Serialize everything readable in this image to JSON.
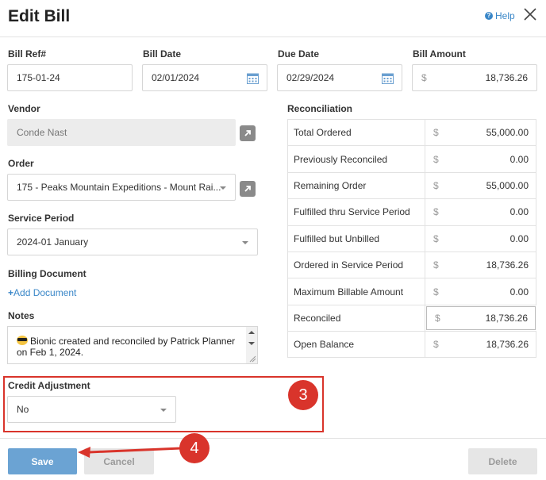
{
  "header": {
    "title": "Edit Bill",
    "help_label": "Help"
  },
  "fields": {
    "bill_ref": {
      "label": "Bill Ref#",
      "value": "175-01-24"
    },
    "bill_date": {
      "label": "Bill Date",
      "value": "02/01/2024"
    },
    "due_date": {
      "label": "Due Date",
      "value": "02/29/2024"
    },
    "bill_amount": {
      "label": "Bill Amount",
      "currency": "$",
      "value": "18,736.26"
    },
    "vendor": {
      "label": "Vendor",
      "value": "Conde Nast"
    },
    "order": {
      "label": "Order",
      "value": "175 - Peaks Mountain Expeditions - Mount Rai..."
    },
    "service_period": {
      "label": "Service Period",
      "value": "2024-01 January"
    },
    "billing_document": {
      "label": "Billing Document",
      "add_label": "Add Document"
    },
    "notes": {
      "label": "Notes",
      "value": "Bionic created and reconciled by Patrick Planner on Feb 1, 2024."
    },
    "credit_adjustment": {
      "label": "Credit Adjustment",
      "value": "No"
    }
  },
  "reconciliation": {
    "title": "Reconciliation",
    "currency": "$",
    "rows": [
      {
        "label": "Total Ordered",
        "value": "55,000.00"
      },
      {
        "label": "Previously Reconciled",
        "value": "0.00"
      },
      {
        "label": "Remaining Order",
        "value": "55,000.00"
      },
      {
        "label": "Fulfilled thru Service Period",
        "value": "0.00"
      },
      {
        "label": "Fulfilled but Unbilled",
        "value": "0.00"
      },
      {
        "label": "Ordered in Service Period",
        "value": "18,736.26"
      },
      {
        "label": "Maximum Billable Amount",
        "value": "0.00"
      },
      {
        "label": "Reconciled",
        "value": "18,736.26"
      },
      {
        "label": "Open Balance",
        "value": "18,736.26"
      }
    ]
  },
  "annotations": {
    "step_credit": "3",
    "step_save": "4"
  },
  "footer": {
    "save_label": "Save",
    "cancel_label": "Cancel",
    "delete_label": "Delete"
  },
  "colors": {
    "accent": "#3a87c8",
    "save_button": "#6ba3d3",
    "annotation": "#d9342b"
  },
  "icons": [
    "help-icon",
    "close-icon",
    "calendar-icon",
    "external-link-icon",
    "chevron-down-icon",
    "plus-icon",
    "sunglasses-emoji-icon",
    "arrow-icon"
  ]
}
